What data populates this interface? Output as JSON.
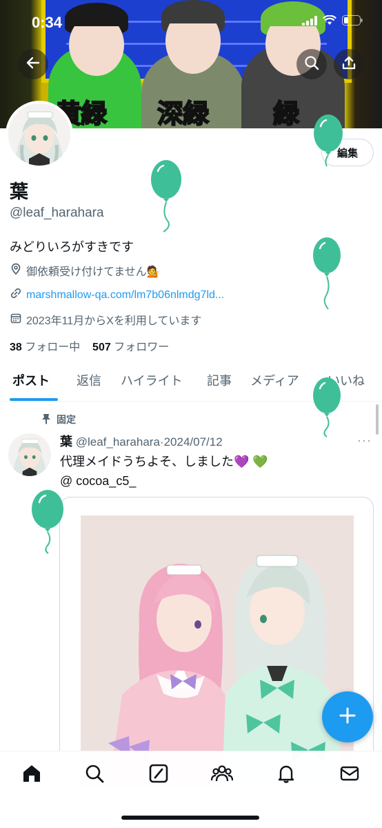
{
  "status_bar": {
    "time": "0:34"
  },
  "banner": {
    "tags": [
      "黄緑",
      "深緑",
      "緑"
    ]
  },
  "profile": {
    "edit_label": "編集",
    "name": "葉",
    "handle": "@leaf_harahara",
    "bio": "みどりいろがすきです",
    "location": "御依頼受け付けてません💁",
    "link": "marshmallow-qa.com/lm7b06nlmdg7ld...",
    "joined": "2023年11月からXを利用しています",
    "following_count": "38",
    "following_label": "フォロー中",
    "followers_count": "507",
    "followers_label": "フォロワー"
  },
  "tabs": [
    "ポスト",
    "返信",
    "ハイライト",
    "記事",
    "メディア",
    "いいね"
  ],
  "post": {
    "pinned_label": "固定",
    "author": "葉",
    "handle": "@leaf_harahara",
    "date": "2024/07/12",
    "text_line1": "代理メイドうちよそ、しました💜 💚",
    "text_line2": "@ cocoa_c5_"
  },
  "icons": {
    "back": "arrow-left-icon",
    "search": "search-icon",
    "share": "share-icon",
    "location": "location-pin-icon",
    "link": "link-icon",
    "calendar": "calendar-icon",
    "pin": "pin-icon",
    "more": "more-dots-icon",
    "compose": "plus-icon",
    "nav": [
      "home-icon",
      "search-icon",
      "grok-icon",
      "communities-icon",
      "bell-icon",
      "mail-icon"
    ]
  },
  "colors": {
    "accent": "#1d9bf0",
    "balloon": "#3fbf98",
    "text": "#0f1419",
    "secondary": "#536471"
  }
}
